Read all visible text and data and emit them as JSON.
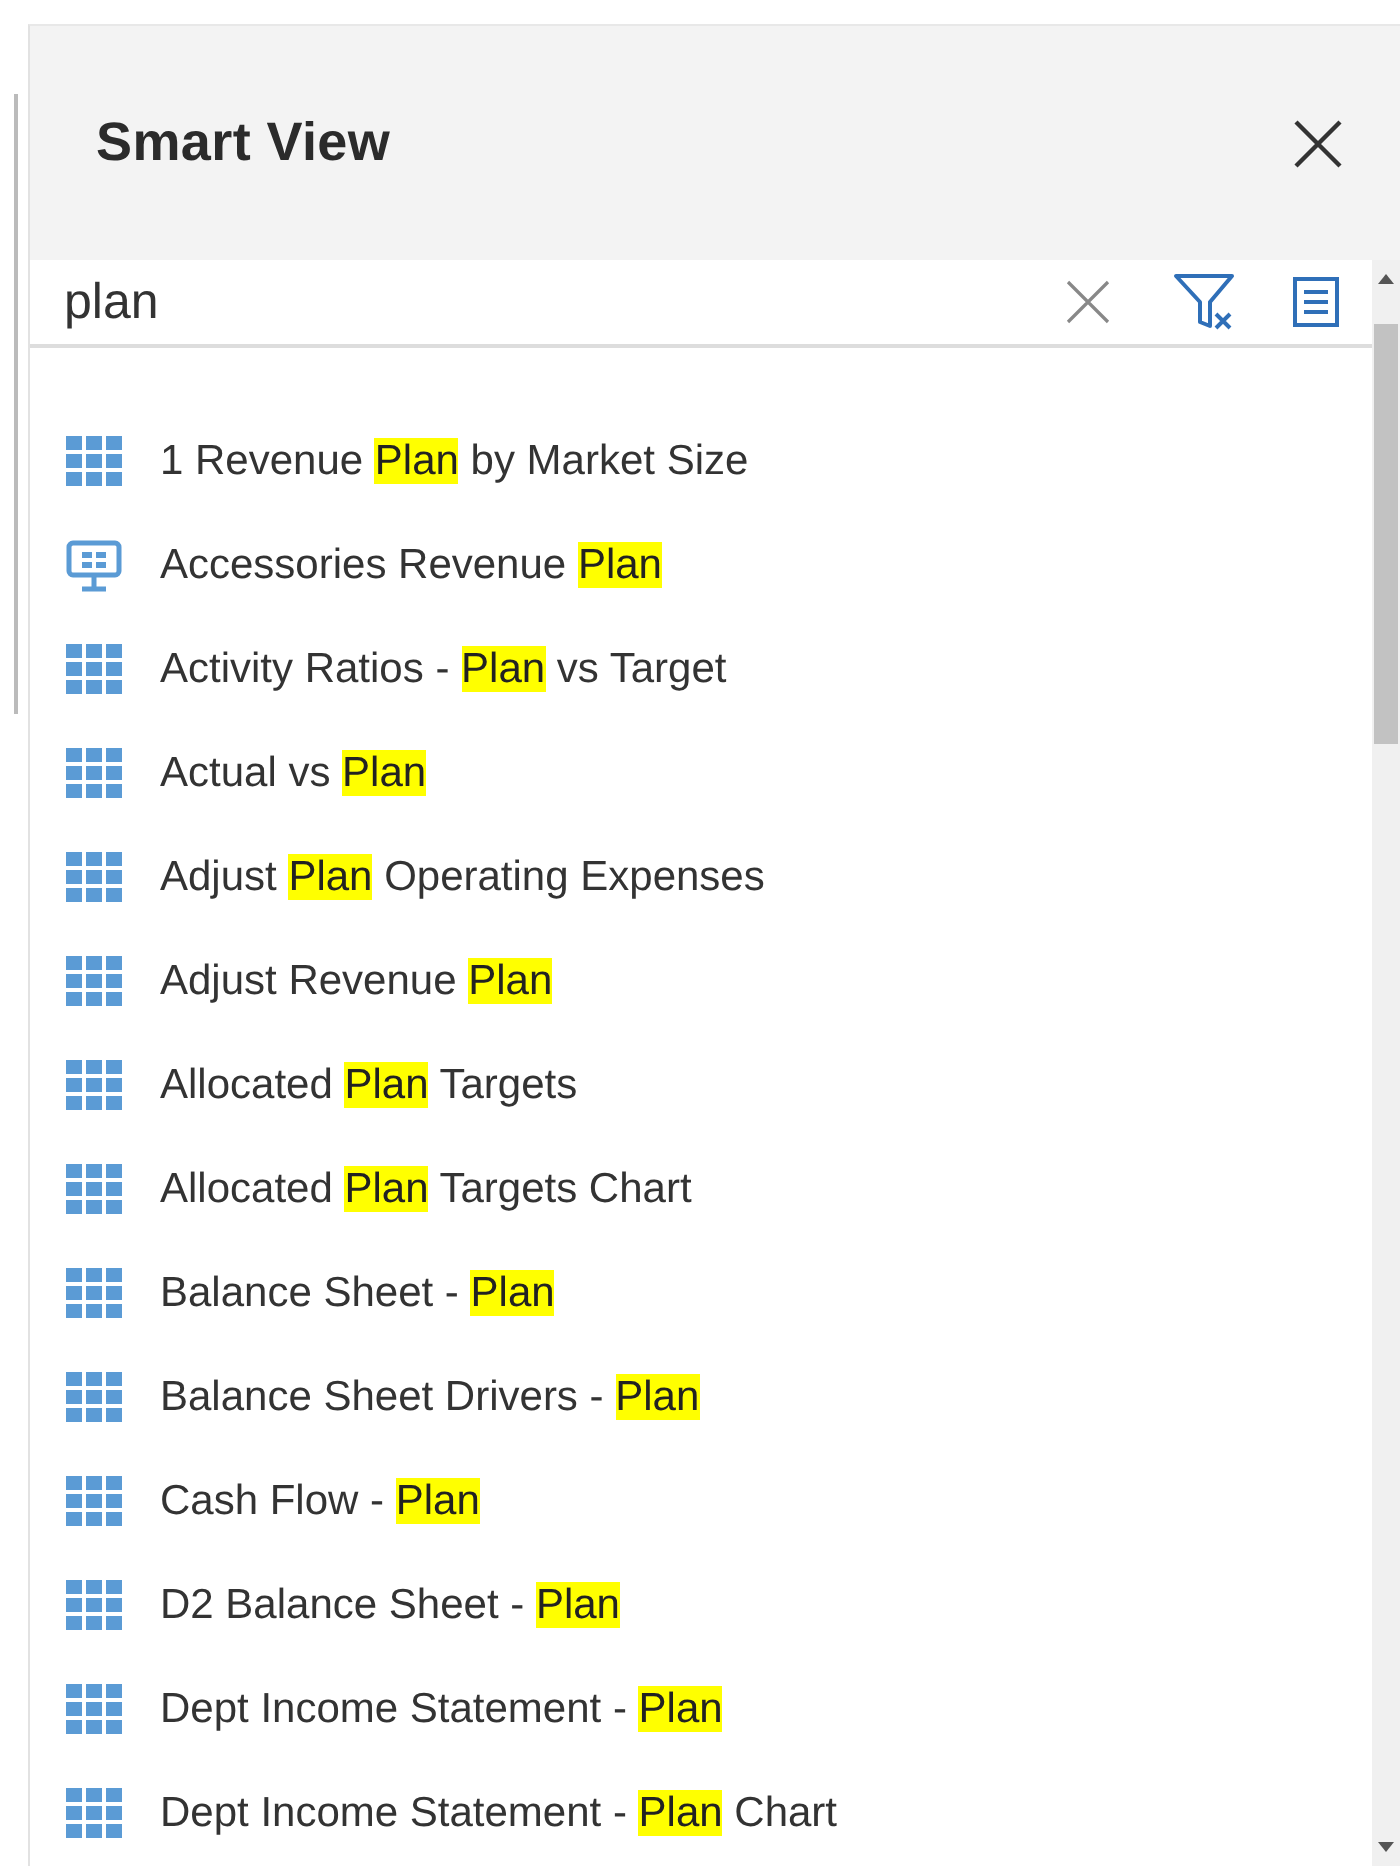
{
  "panel": {
    "title": "Smart View"
  },
  "search": {
    "value": "plan"
  },
  "results": [
    {
      "kind": "grid",
      "before": "1 Revenue ",
      "highlight": "Plan",
      "after": " by Market Size"
    },
    {
      "kind": "display",
      "before": "Accessories Revenue ",
      "highlight": "Plan"
    },
    {
      "kind": "grid",
      "before": "Activity Ratios - ",
      "highlight": "Plan",
      "after": " vs Target"
    },
    {
      "kind": "grid",
      "before": "Actual vs ",
      "highlight": "Plan"
    },
    {
      "kind": "grid",
      "before": "Adjust ",
      "highlight": "Plan",
      "after": " Operating Expenses"
    },
    {
      "kind": "grid",
      "before": "Adjust Revenue ",
      "highlight": "Plan"
    },
    {
      "kind": "grid",
      "before": "Allocated ",
      "highlight": "Plan",
      "after": " Targets"
    },
    {
      "kind": "grid",
      "before": "Allocated ",
      "highlight": "Plan",
      "after": " Targets Chart"
    },
    {
      "kind": "grid",
      "before": "Balance Sheet - ",
      "highlight": "Plan"
    },
    {
      "kind": "grid",
      "before": "Balance Sheet Drivers - ",
      "highlight": "Plan"
    },
    {
      "kind": "grid",
      "before": "Cash Flow - ",
      "highlight": "Plan"
    },
    {
      "kind": "grid",
      "before": "D2 Balance Sheet - ",
      "highlight": "Plan"
    },
    {
      "kind": "grid",
      "before": "Dept Income Statement - ",
      "highlight": "Plan"
    },
    {
      "kind": "grid",
      "before": "Dept Income Statement - ",
      "highlight": "Plan",
      "after": " Chart"
    }
  ]
}
